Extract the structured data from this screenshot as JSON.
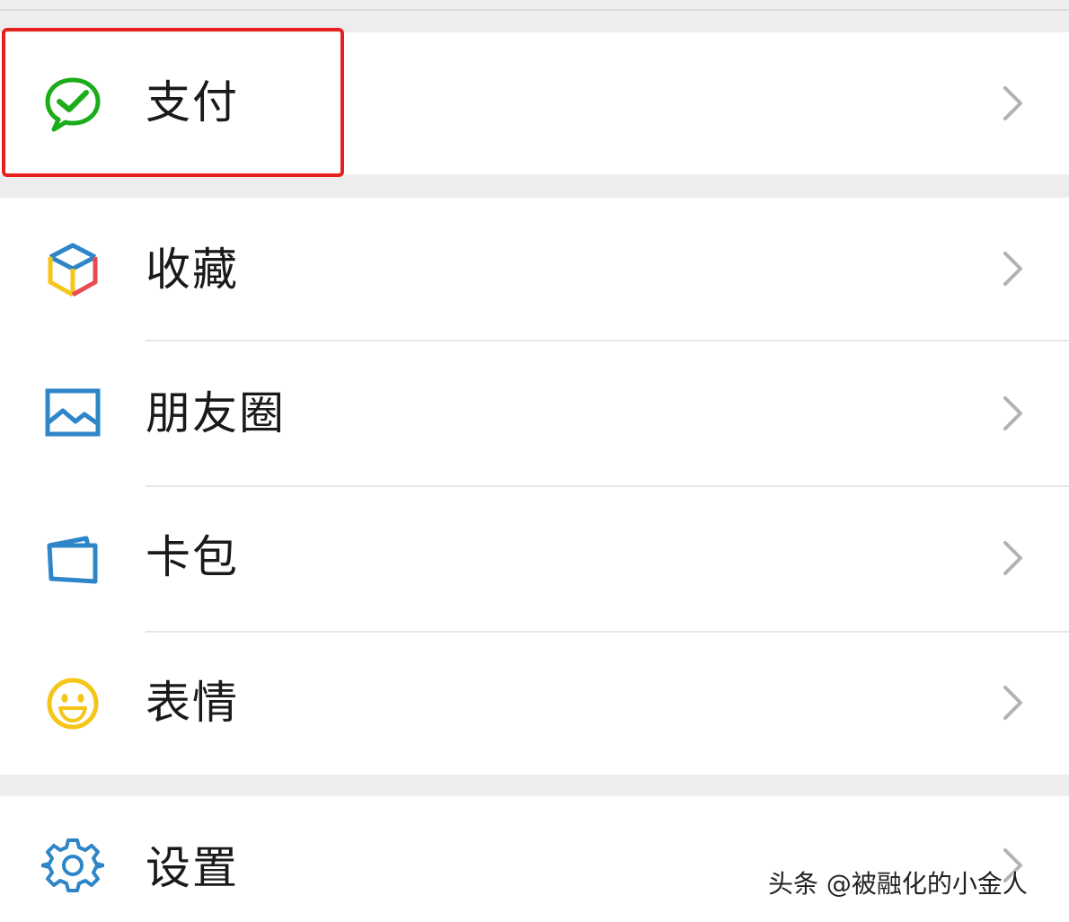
{
  "menu": {
    "pay": {
      "label": "支付",
      "icon": "wechat-pay-icon",
      "color": "#1aad19"
    },
    "favorites": {
      "label": "收藏",
      "icon": "cube-icon"
    },
    "moments": {
      "label": "朋友圈",
      "icon": "landscape-image-icon",
      "color": "#2e86c8"
    },
    "cards": {
      "label": "卡包",
      "icon": "card-wallet-icon",
      "color": "#2e86c8"
    },
    "stickers": {
      "label": "表情",
      "icon": "smiley-face-icon",
      "color": "#f5c518"
    },
    "settings": {
      "label": "设置",
      "icon": "gear-icon",
      "color": "#2e86c8"
    }
  },
  "highlight_color": "#e8201c",
  "watermark": "头条 @被融化的小金人"
}
